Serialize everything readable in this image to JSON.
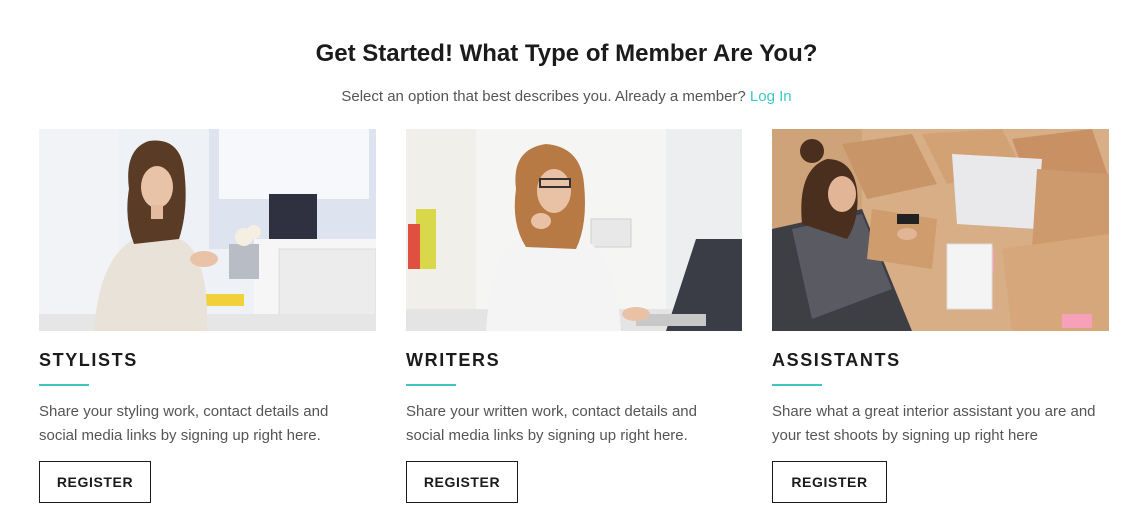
{
  "header": {
    "title": "Get Started! What Type of Member Are You?",
    "subtitle": "Select an option that best describes you. Already a member?",
    "login_link": "Log In"
  },
  "cards": [
    {
      "title": "STYLISTS",
      "description": "Share your styling work, contact details and social media links by signing up right here.",
      "button": "REGISTER"
    },
    {
      "title": "WRITERS",
      "description": "Share your written work, contact details and social media links by signing up right here.",
      "button": "REGISTER"
    },
    {
      "title": "ASSISTANTS",
      "description": "Share what a great interior assistant you are and your test shoots by signing up right here",
      "button": "REGISTER"
    }
  ],
  "colors": {
    "accent": "#3ec7c4",
    "text_dark": "#1b1b1b",
    "text_muted": "#555555"
  }
}
